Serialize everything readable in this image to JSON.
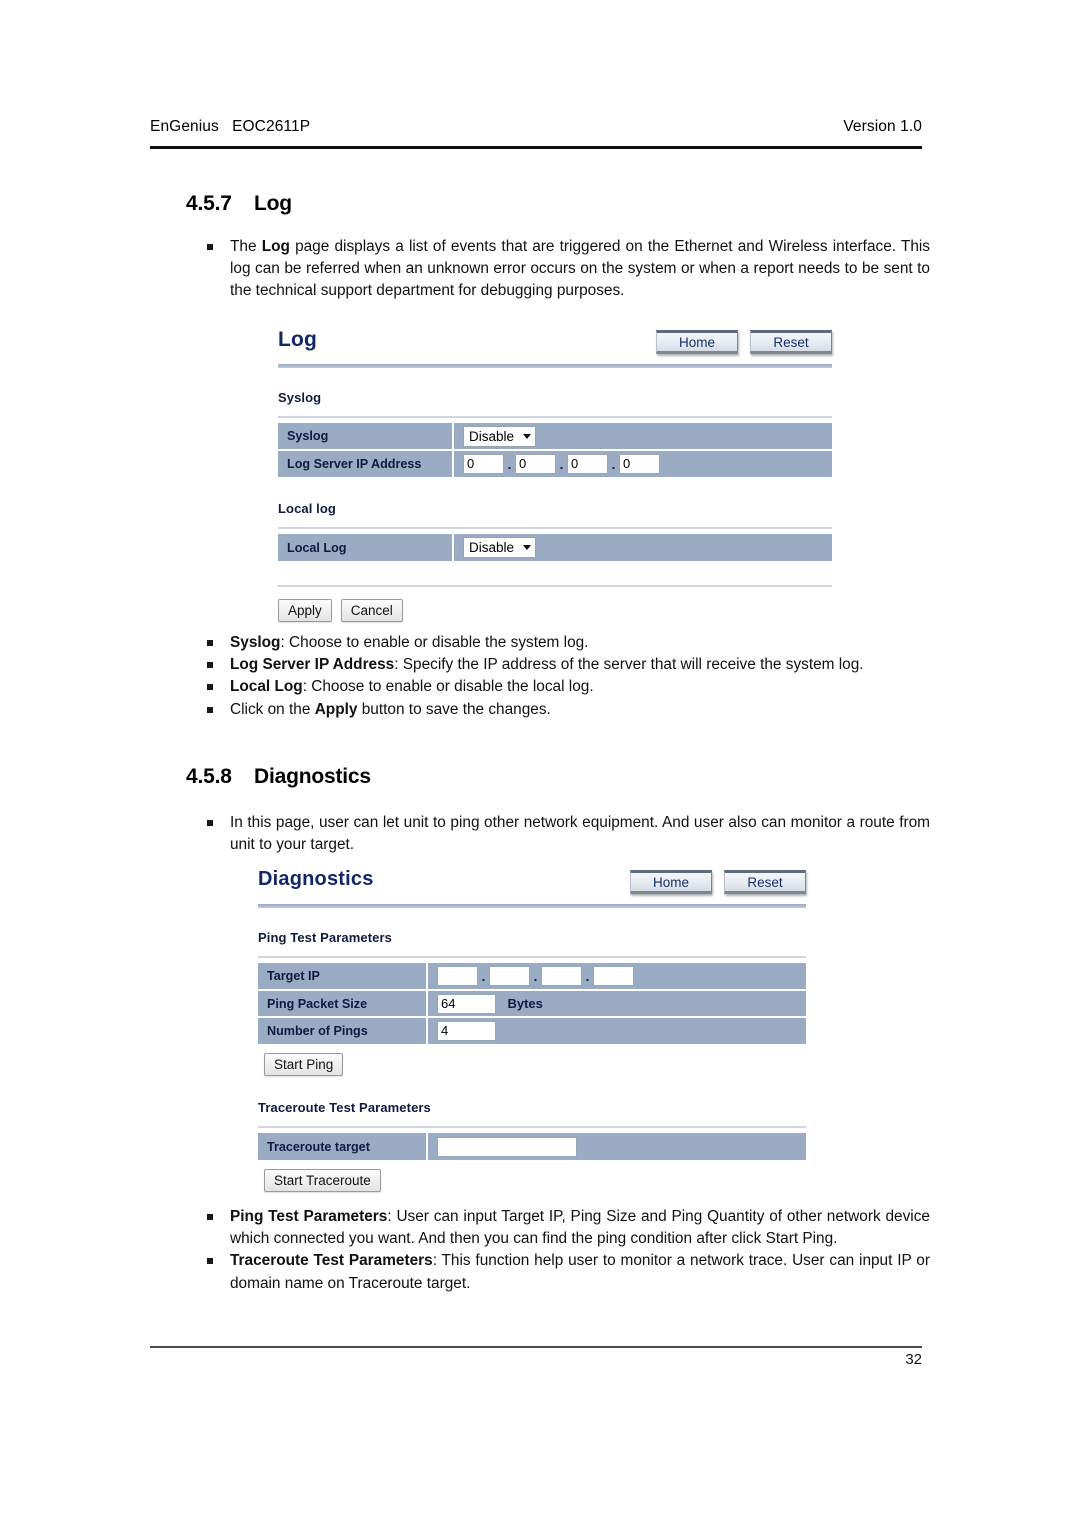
{
  "doc": {
    "header_left": "EnGenius   EOC2611P",
    "header_right": "Version 1.0",
    "page_number": "32"
  },
  "sections": [
    {
      "number": "4.5.7",
      "title": "Log",
      "intro": "The Log page displays a list of events that are triggered on the Ethernet and Wireless interface. This log can be referred when an unknown error occurs on the system or when a report needs to be sent to the technical support department for debugging purposes.",
      "intro_bold": "Log"
    },
    {
      "number": "4.5.8",
      "title": "Diagnostics",
      "intro": "In this page, user can let unit to ping other network equipment. And user also can monitor a route from unit to your target."
    }
  ],
  "log_panel": {
    "title": "Log",
    "home_label": "Home",
    "reset_label": "Reset",
    "syslog_section_label": "Syslog",
    "rows": [
      {
        "label": "Syslog",
        "type": "select",
        "value": "Disable"
      },
      {
        "label": "Log Server IP Address",
        "type": "ip",
        "octets": [
          "0",
          "0",
          "0",
          "0"
        ]
      }
    ],
    "local_section_label": "Local log",
    "local_rows": [
      {
        "label": "Local Log",
        "type": "select",
        "value": "Disable"
      }
    ],
    "apply_label": "Apply",
    "cancel_label": "Cancel"
  },
  "log_bullets": [
    {
      "bold": "Syslog",
      "rest": ": Choose to enable or disable the system log."
    },
    {
      "bold": "Log Server IP Address",
      "rest": ": Specify the IP address of the server that will receive the system log."
    },
    {
      "bold": "Local Log",
      "rest": ": Choose to enable or disable the local log."
    },
    {
      "pre": "Click on the ",
      "bold": "Apply",
      "rest": " button to save the changes."
    }
  ],
  "diag_panel": {
    "title": "Diagnostics",
    "home_label": "Home",
    "reset_label": "Reset",
    "ping_section_label": "Ping Test Parameters",
    "ping_rows": [
      {
        "label": "Target IP",
        "type": "ip",
        "octets": [
          "",
          "",
          "",
          ""
        ]
      },
      {
        "label": "Ping Packet Size",
        "type": "text",
        "value": "64",
        "unit": "Bytes"
      },
      {
        "label": "Number of Pings",
        "type": "text",
        "value": "4",
        "unit": ""
      }
    ],
    "start_ping_label": "Start Ping",
    "trace_section_label": "Traceroute Test Parameters",
    "trace_rows": [
      {
        "label": "Traceroute target",
        "type": "wide",
        "value": ""
      }
    ],
    "start_traceroute_label": "Start Traceroute"
  },
  "diag_bullets": [
    {
      "bold": "Ping Test Parameters",
      "rest": ": User can input Target IP, Ping Size and Ping Quantity of other network device which connected you want. And then you can find the ping condition after click Start Ping."
    },
    {
      "bold": "Traceroute Test Parameters",
      "rest": ": This function help user to monitor a network trace. User can input IP or domain name on Traceroute target."
    }
  ]
}
